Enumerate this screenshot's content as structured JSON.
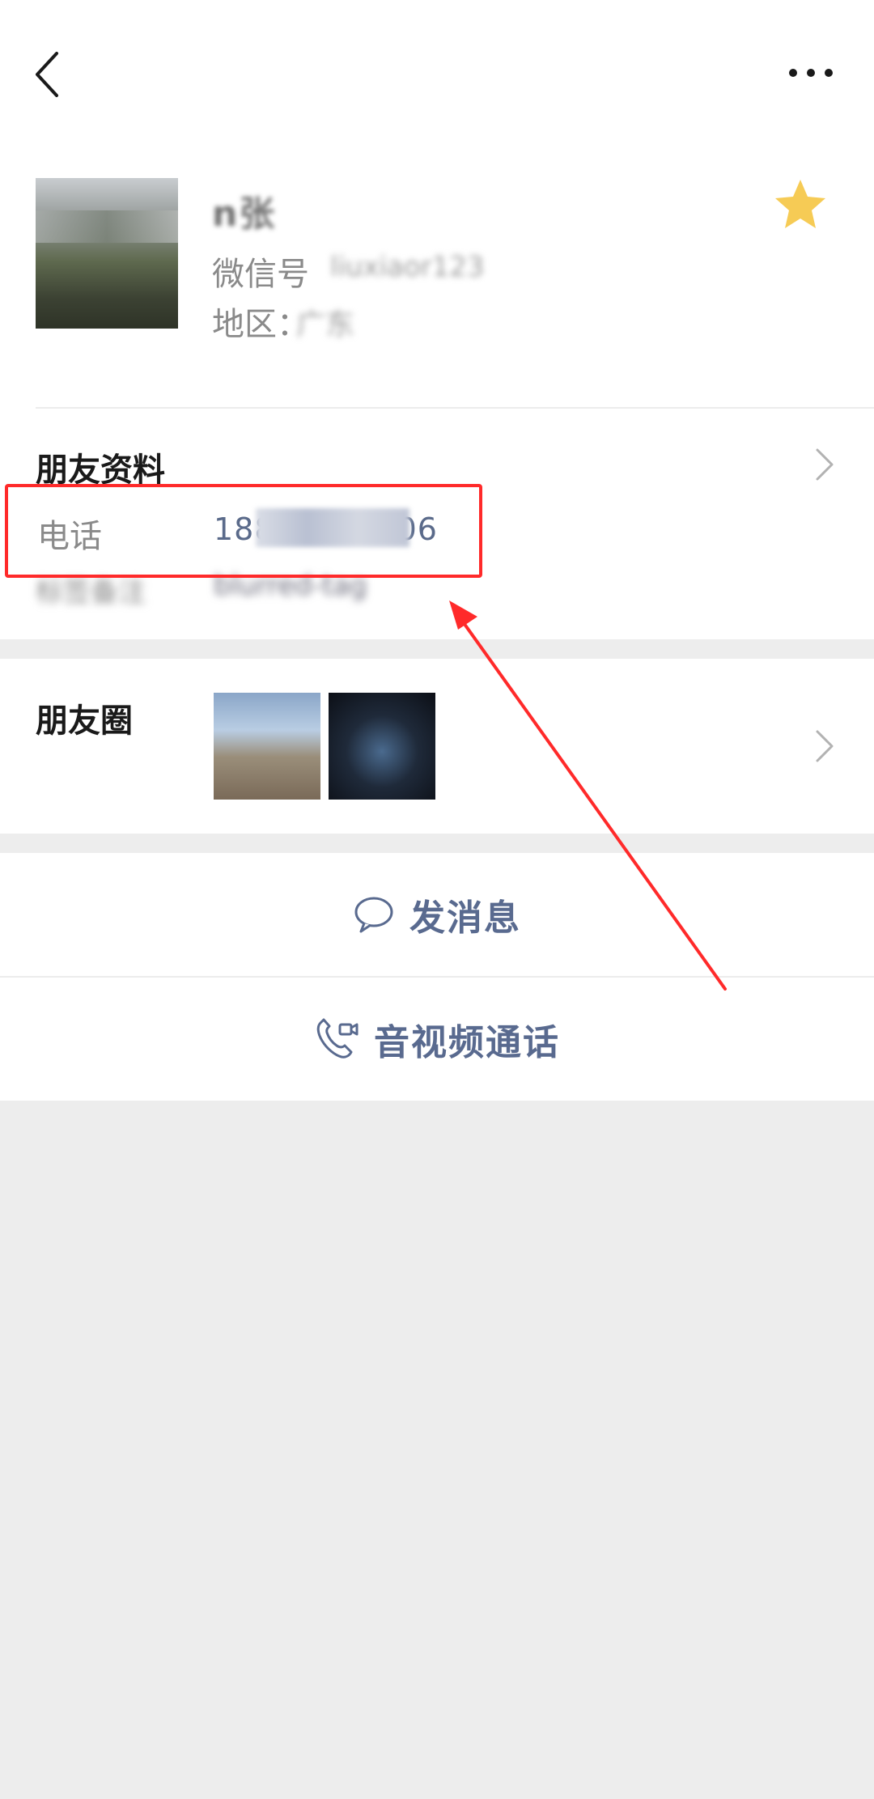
{
  "header": {
    "back_icon": "chevron-left-icon",
    "more_icon": "ellipsis-icon"
  },
  "profile": {
    "name": "n张",
    "wechat_id_label": "微信号",
    "wechat_id_value": "liuxiaor123",
    "region_label": "地区：",
    "region_value": "广东",
    "star_icon": "star-icon",
    "star_color": "#f5c542"
  },
  "friend_info": {
    "title": "朋友资料",
    "phone_label": "电话",
    "phone_value": "18800000006",
    "extra_label": "标签备注",
    "extra_value": "blurred-tag"
  },
  "moments": {
    "label": "朋友圈"
  },
  "actions": {
    "message_label": "发消息",
    "call_label": "音视频通话",
    "accent_color": "#596a8f"
  },
  "annotation": {
    "highlight_color": "#ff2a2a"
  }
}
